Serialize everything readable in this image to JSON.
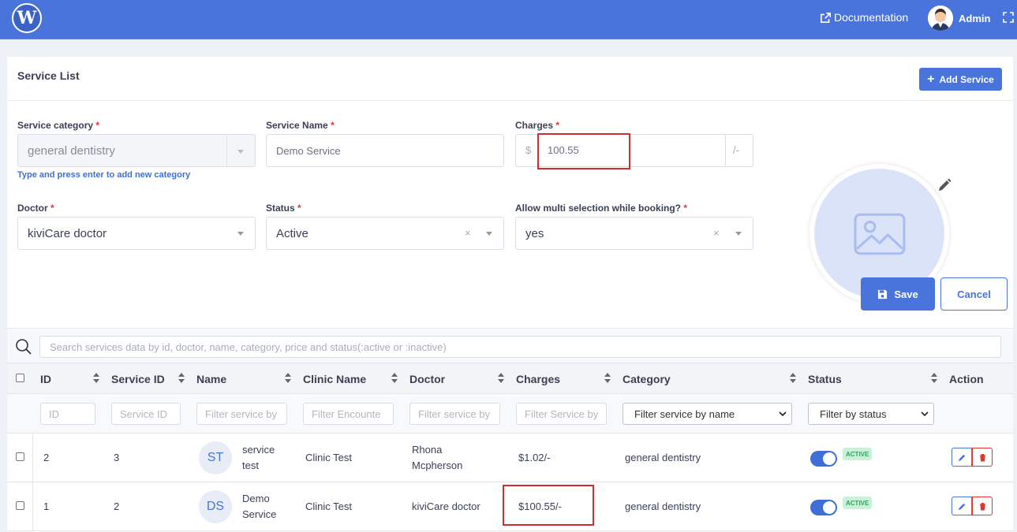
{
  "topbar": {
    "logo_letter": "W",
    "documentation_label": "Documentation",
    "user_name": "Admin"
  },
  "page": {
    "title": "Service List",
    "add_button_label": "Add Service"
  },
  "form": {
    "category_label": "Service category",
    "category_value": "general dentistry",
    "category_hint": "Type and press enter to add new category",
    "name_label": "Service Name",
    "name_value": "Demo Service",
    "charges_label": "Charges",
    "charges_currency": "$",
    "charges_value": "100.55",
    "charges_suffix": "/-",
    "doctor_label": "Doctor",
    "doctor_value": "kiviCare doctor",
    "status_label": "Status",
    "status_value": "Active",
    "multi_label": "Allow multi selection while booking?",
    "multi_value": "yes",
    "required_mark": "*",
    "clear_mark": "×",
    "save_label": "Save",
    "cancel_label": "Cancel"
  },
  "table": {
    "search_placeholder": "Search services data by id, doctor, name, category, price  and status(:active or :inactive)",
    "columns": [
      "ID",
      "Service ID",
      "Name",
      "Clinic Name",
      "Doctor",
      "Charges",
      "Category",
      "Status",
      "Action"
    ],
    "filters": {
      "id": "ID",
      "service_id": "Service ID",
      "name": "Filter service by",
      "clinic": "Filter Encounte",
      "doctor": "Filter service by",
      "charges": "Filter Service by",
      "category": "Filter service by name",
      "status": "Filter by status"
    },
    "rows": [
      {
        "id": "2",
        "service_id": "3",
        "initials": "ST",
        "name_line1": "service",
        "name_line2": "test",
        "clinic": "Clinic Test",
        "doctor_line1": "Rhona",
        "doctor_line2": "Mcpherson",
        "charges": "$1.02/-",
        "category": "general dentistry",
        "status_badge": "ACTIVE"
      },
      {
        "id": "1",
        "service_id": "2",
        "initials": "DS",
        "name_line1": "Demo",
        "name_line2": "Service",
        "clinic": "Clinic Test",
        "doctor_line1": "kiviCare doctor",
        "doctor_line2": "",
        "charges": "$100.55/-",
        "category": "general dentistry",
        "status_badge": "ACTIVE"
      }
    ]
  },
  "colors": {
    "brand": "#4874dc",
    "danger": "#e0342f",
    "success": "#2aa65a",
    "highlight": "#d62b2b"
  }
}
